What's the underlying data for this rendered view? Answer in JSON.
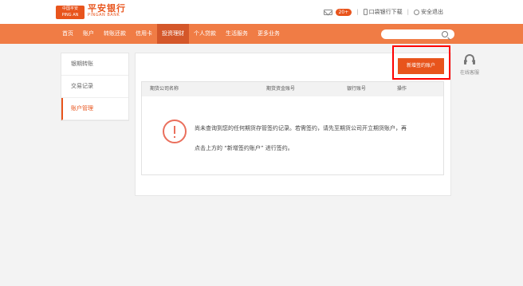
{
  "brand": {
    "emblem_line1": "中国平安",
    "emblem_line2": "PING AN",
    "name_cn": "平安银行",
    "name_en": "PINGAN BANK"
  },
  "top_links": {
    "messages_badge": "20+",
    "download_label": "口袋银行下载",
    "logout_label": "安全退出"
  },
  "nav": {
    "items": [
      "首页",
      "账户",
      "转账还款",
      "信用卡",
      "投资理财",
      "个人贷款",
      "生活服务",
      "更多业务"
    ],
    "active": "投资理财"
  },
  "sidebar": {
    "items": [
      "银期转账",
      "交易记录",
      "账户管理"
    ],
    "active": "账户管理"
  },
  "main": {
    "new_account_button": "新增签约账户",
    "table_headers": [
      "期货公司名称",
      "期货资金账号",
      "银行账号",
      "操作"
    ],
    "empty_line1": "尚未查询到您的任何期货存管签约记录。若需签约，请先至期货公司开立期货账户，再",
    "empty_line2": "点击上方的 “新增签约账户” 进行签约。"
  },
  "service": {
    "label": "在线客服"
  },
  "colors": {
    "brand_orange": "#e8541c",
    "nav_bar": "#f07c45",
    "nav_active": "#d4572a",
    "highlight_red": "#ff0000",
    "warning": "#ea6f5c"
  },
  "icons": [
    "mail-icon",
    "phone-icon",
    "exit-icon",
    "search-icon",
    "warning-icon",
    "headset-icon"
  ]
}
